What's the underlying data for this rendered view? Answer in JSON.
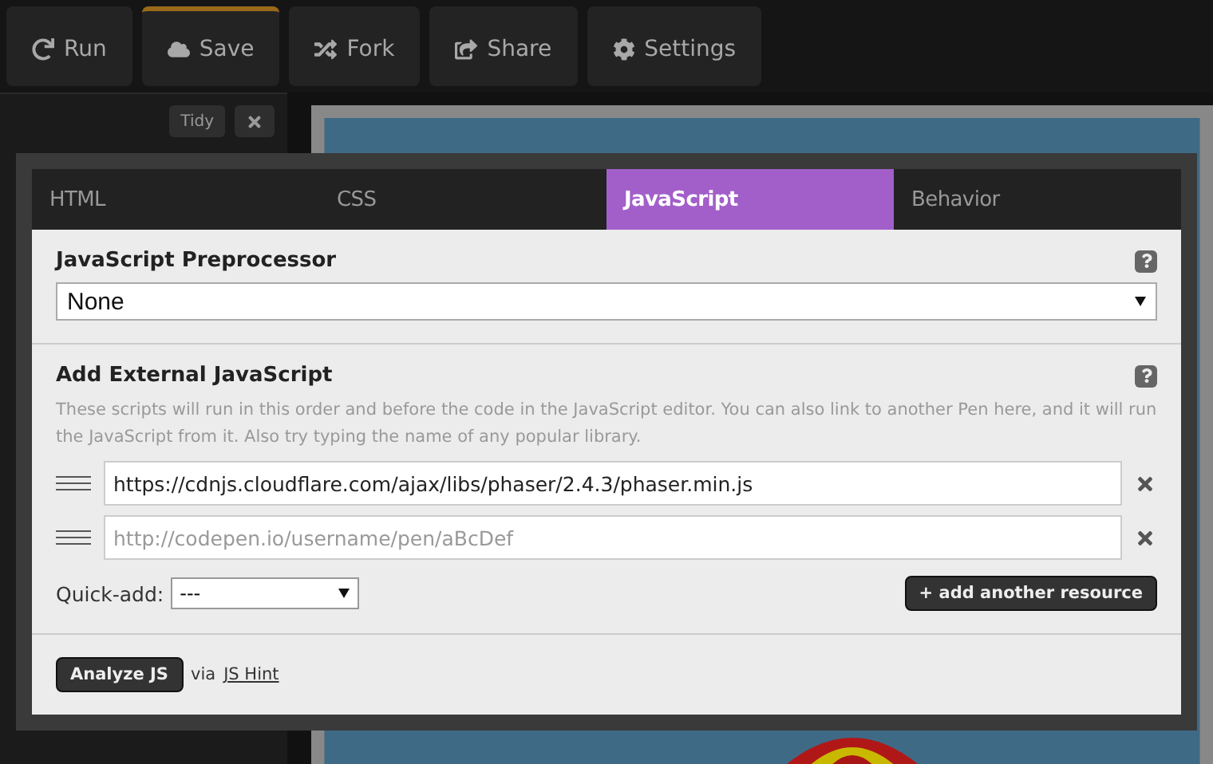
{
  "toolbar": [
    {
      "kind": "run",
      "label": "Run",
      "selected": false
    },
    {
      "kind": "save",
      "label": "Save",
      "selected": true
    },
    {
      "kind": "fork",
      "label": "Fork",
      "selected": false
    },
    {
      "kind": "share",
      "label": "Share",
      "selected": false
    },
    {
      "kind": "settings",
      "label": "Settings",
      "selected": false
    }
  ],
  "editor": {
    "tidy": "Tidy"
  },
  "modal": {
    "tabs": [
      {
        "label": "HTML",
        "selected": false
      },
      {
        "label": "CSS",
        "selected": false
      },
      {
        "label": "JavaScript",
        "selected": true
      },
      {
        "label": "Behavior",
        "selected": false
      }
    ],
    "preprocessor": {
      "title": "JavaScript Preprocessor",
      "value": "None"
    },
    "external": {
      "title": "Add External JavaScript",
      "description": "These scripts will run in this order and before the code in the JavaScript editor. You can also link to another Pen here, and it will run the JavaScript from it. Also try typing the name of any popular library.",
      "resources": [
        {
          "value": "https://cdnjs.cloudflare.com/ajax/libs/phaser/2.4.3/phaser.min.js"
        },
        {
          "placeholder": "http://codepen.io/username/pen/aBcDef"
        }
      ],
      "quick_add_label": "Quick-add:",
      "quick_add_value": "---",
      "add_button": "+ add another resource"
    },
    "analyze": {
      "button": "Analyze JS",
      "via": "via",
      "link": "JS Hint"
    }
  }
}
